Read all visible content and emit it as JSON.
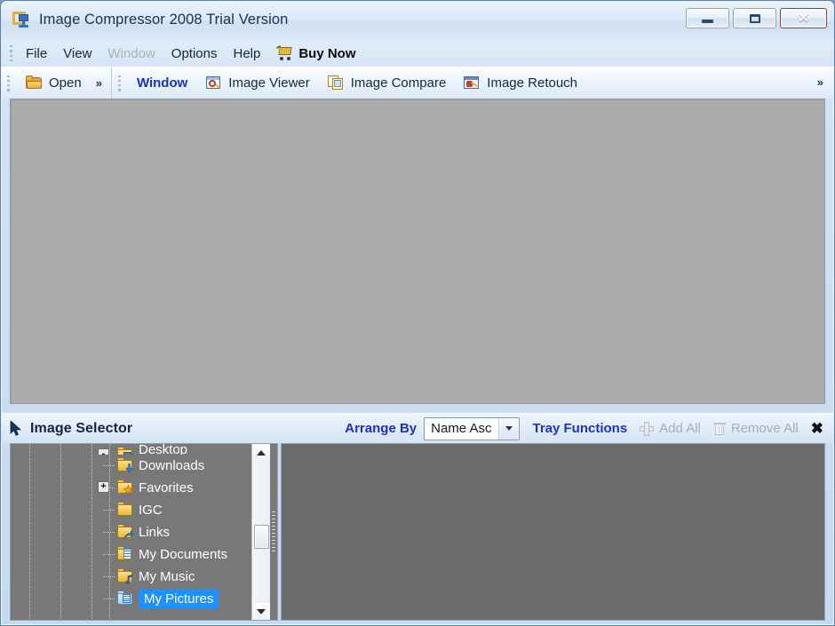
{
  "window": {
    "title": "Image Compressor 2008 Trial Version",
    "app_icon": "monitor-icon",
    "buttons": {
      "minimize": "minimize-button",
      "maximize": "maximize-button",
      "close": "✕"
    }
  },
  "menubar": {
    "items": [
      {
        "label": "File",
        "disabled": false
      },
      {
        "label": "View",
        "disabled": false
      },
      {
        "label": "Window",
        "disabled": true
      },
      {
        "label": "Options",
        "disabled": false
      },
      {
        "label": "Help",
        "disabled": false
      }
    ],
    "buy_now": {
      "label": "Buy Now",
      "icon": "shopping-cart-icon"
    }
  },
  "toolbar": {
    "file_group": {
      "open_label": "Open",
      "open_icon": "folder-open-icon",
      "overflow_chevron": "»"
    },
    "window_group": {
      "window_label": "Window",
      "items": [
        {
          "label": "Image Viewer",
          "icon": "image-viewer-icon"
        },
        {
          "label": "Image Compare",
          "icon": "image-compare-icon"
        },
        {
          "label": "Image Retouch",
          "icon": "image-retouch-icon"
        }
      ]
    },
    "right_chevron": "»"
  },
  "selector_bar": {
    "cursor_icon": "mouse-pointer-icon",
    "title": "Image Selector",
    "arrange_by_label": "Arrange By",
    "arrange_by_value": "Name Asc",
    "arrange_by_options": [
      "Name Asc"
    ],
    "tray_functions_label": "Tray Functions",
    "add_all": {
      "label": "Add All",
      "icon": "plus-icon",
      "disabled": true
    },
    "remove_all": {
      "label": "Remove All",
      "icon": "trash-icon",
      "disabled": true
    },
    "close_label": "✖"
  },
  "tree": {
    "nodes": [
      {
        "label": "Desktop",
        "icon": "folder-desktop-icon",
        "expander": "-",
        "selected": false,
        "clipped": true
      },
      {
        "label": "Downloads",
        "icon": "folder-downloads-icon",
        "expander": "",
        "selected": false,
        "clipped": false
      },
      {
        "label": "Favorites",
        "icon": "folder-favorites-icon",
        "expander": "+",
        "selected": false,
        "clipped": false
      },
      {
        "label": "IGC",
        "icon": "folder-icon",
        "expander": "",
        "selected": false,
        "clipped": false
      },
      {
        "label": "Links",
        "icon": "folder-links-icon",
        "expander": "",
        "selected": false,
        "clipped": false
      },
      {
        "label": "My Documents",
        "icon": "folder-documents-icon",
        "expander": "",
        "selected": false,
        "clipped": false
      },
      {
        "label": "My Music",
        "icon": "folder-music-icon",
        "expander": "",
        "selected": false,
        "clipped": false
      },
      {
        "label": "My Pictures",
        "icon": "folder-pictures-icon",
        "expander": "",
        "selected": true,
        "clipped": false
      }
    ],
    "scrollbar": {
      "up_arrow": "scroll-up-arrow",
      "down_arrow": "scroll-down-arrow"
    }
  },
  "colors": {
    "accent_blue": "#1b32c8",
    "selection_blue": "#1e90ff",
    "canvas_gray": "#ababab",
    "tree_gray": "#787878",
    "tray_gray": "#6b6b6b",
    "close_red": "#cc3c22"
  }
}
